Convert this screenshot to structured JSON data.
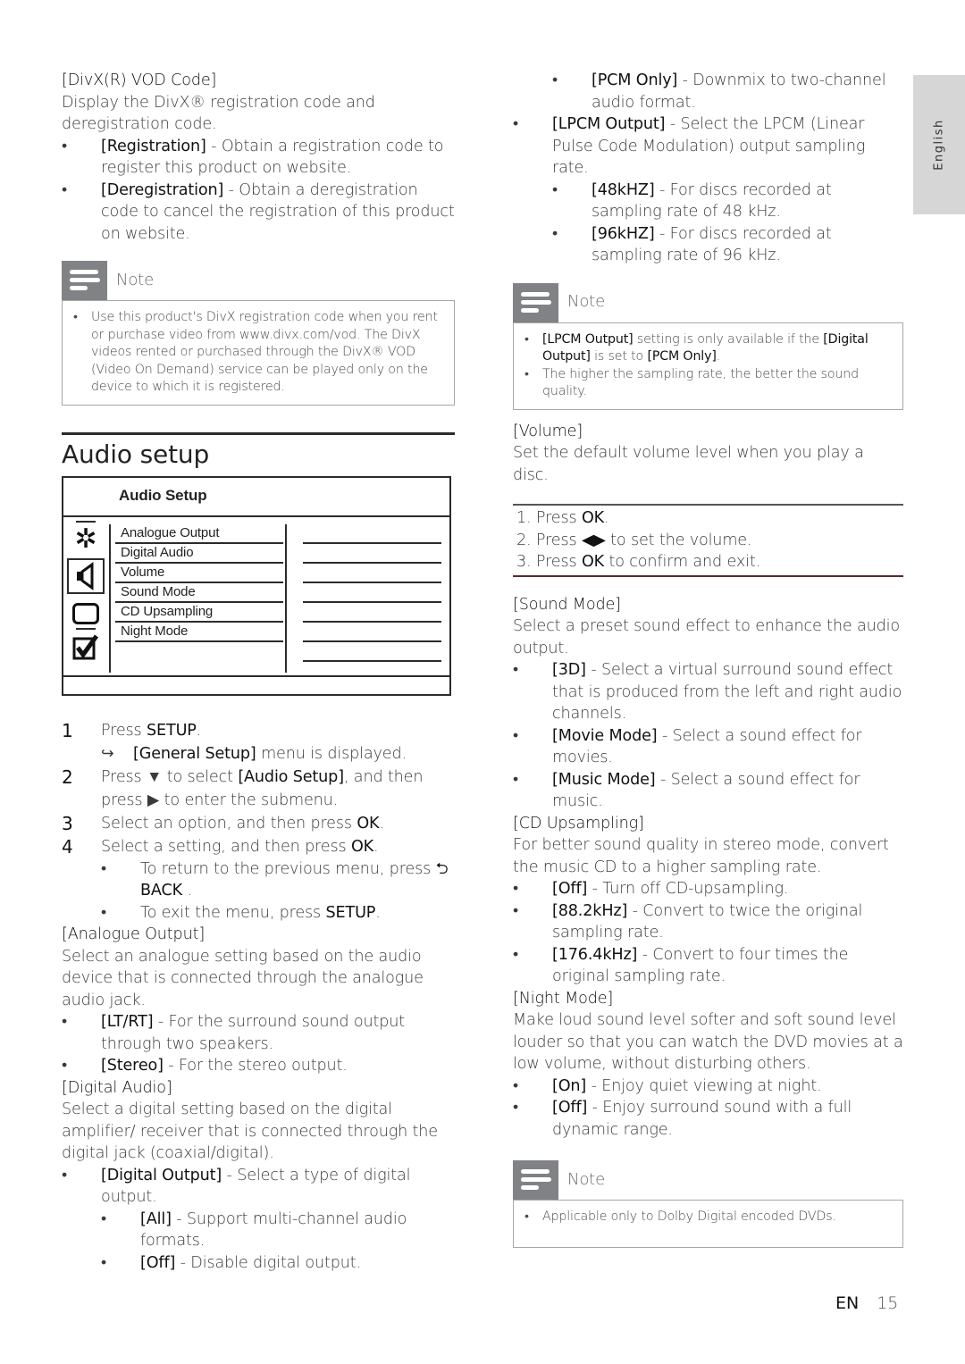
{
  "side_tab": {
    "label": "English"
  },
  "left": {
    "divx": {
      "heading": "[DivX(R) VOD Code]",
      "desc": "Display the DivX® registration code and deregistration code.",
      "items": [
        {
          "key": "[Registration]",
          "text": " - Obtain a registration code to register this product on website."
        },
        {
          "key": "[Deregistration]",
          "text": " - Obtain a deregistration code to cancel the registration of this product on website."
        }
      ]
    },
    "note1": {
      "label": "Note",
      "items": [
        "Use this product's DivX registration code when you rent or purchase video from www.divx.com/vod. The DivX videos rented or purchased through the DivX® VOD (Video On Demand) service can be played only on the device to which it is registered."
      ]
    },
    "section_title": "Audio setup",
    "menu": {
      "title": "Audio Setup",
      "options": [
        "Analogue Output",
        "Digital Audio",
        "Volume",
        "Sound Mode",
        "CD Upsampling",
        "Night Mode"
      ],
      "icons": [
        "gear-icon",
        "speaker-icon",
        "screen-icon",
        "checkbox-icon"
      ],
      "selected_icon": "speaker-icon"
    },
    "steps": [
      {
        "num": "1",
        "pre": "Press ",
        "bold": "SETUP",
        "post": "."
      },
      {
        "num": "2",
        "pre": "Press ▼ to select ",
        "bold": "[Audio Setup]",
        "post": ", and then press ▶ to enter the submenu."
      },
      {
        "num": "3",
        "pre": "Select an option, and then press ",
        "bold": "OK",
        "post": "."
      },
      {
        "num": "4",
        "pre": "Select a setting, and then press ",
        "bold": "OK",
        "post": "."
      }
    ],
    "step1_result": {
      "bold": "[General Setup]",
      "post": " menu is displayed."
    },
    "step4_bullets": [
      {
        "pre": "To return to the previous menu, press ",
        "bold": "⮌ BACK",
        "post": " ."
      },
      {
        "pre": "To exit the menu, press ",
        "bold": "SETUP",
        "post": "."
      }
    ],
    "analogue": {
      "heading": "[Analogue Output]",
      "desc": "Select an analogue setting based on the audio device that is connected through the analogue audio jack.",
      "items": [
        {
          "key": "[LT/RT]",
          "text": " - For the surround sound output through two speakers."
        },
        {
          "key": "[Stereo]",
          "text": " - For the stereo output."
        }
      ]
    },
    "digital": {
      "heading": "[Digital Audio]",
      "desc": "Select a digital setting based on the digital amplifier/ receiver that is connected through the digital jack (coaxial/digital).",
      "items": [
        {
          "key": "[Digital Output]",
          "text": " - Select a type of digital output."
        }
      ],
      "sub_items": [
        {
          "key": "[All]",
          "text": " - Support multi-channel audio formats."
        },
        {
          "key": "[Off]",
          "text": " - Disable digital output."
        }
      ]
    }
  },
  "right": {
    "pcm_only": {
      "key": "[PCM Only]",
      "text": " - Downmix to two-channel audio format."
    },
    "lpcm": {
      "key": "[LPCM Output]",
      "text": " - Select the LPCM (Linear Pulse Code Modulation) output sampling rate."
    },
    "lpcm_sub": [
      {
        "key": "[48kHZ]",
        "text": " - For discs recorded at sampling rate of 48 kHz."
      },
      {
        "key": "[96kHZ]",
        "text": " - For discs recorded at sampling rate of 96 kHz."
      }
    ],
    "note2": {
      "label": "Note",
      "item1": {
        "b1": "[LPCM Output]",
        "t1": " setting is only available if the ",
        "b2": "[Digital Output]",
        "t2": " is set to ",
        "b3": "[PCM Only]",
        "t3": "."
      },
      "item2": "The higher the sampling rate, the better the sound quality."
    },
    "volume": {
      "heading": "[Volume]",
      "desc": "Set the default volume level when you play a disc.",
      "steps": [
        {
          "pre": "1. Press ",
          "bold": "OK",
          "post": "."
        },
        {
          "pre": "2. Press ",
          "bold": "◀▶",
          "post": " to set the volume."
        },
        {
          "pre": "3. Press ",
          "bold": "OK",
          "post": " to confirm and exit."
        }
      ]
    },
    "sound_mode": {
      "heading": "[Sound Mode]",
      "desc": "Select a preset sound effect to enhance the audio output.",
      "items": [
        {
          "key": "[3D]",
          "text": " - Select a virtual surround sound effect that is produced from the left and right audio channels."
        },
        {
          "key": "[Movie Mode]",
          "text": " - Select a sound effect for movies."
        },
        {
          "key": "[Music Mode]",
          "text": " - Select a sound effect for music."
        }
      ]
    },
    "cd_upsampling": {
      "heading": "[CD Upsampling]",
      "desc": "For better sound quality in stereo mode, convert the music CD to a higher sampling rate.",
      "items": [
        {
          "key": "[Off]",
          "text": " - Turn off CD-upsampling."
        },
        {
          "key": "[88.2kHz]",
          "text": " - Convert to twice the original sampling rate."
        },
        {
          "key": "[176.4kHz]",
          "text": " - Convert to four times the original sampling rate."
        }
      ]
    },
    "night_mode": {
      "heading": "[Night Mode]",
      "desc": "Make loud sound level softer and soft sound level louder so that you can watch the DVD movies at a low volume, without disturbing others.",
      "items": [
        {
          "key": "[On]",
          "text": " - Enjoy quiet viewing at night."
        },
        {
          "key": "[Off]",
          "text": " - Enjoy surround sound with a full dynamic range."
        }
      ]
    },
    "note3": {
      "label": "Note",
      "items": [
        "Applicable only to Dolby Digital encoded DVDs."
      ]
    }
  },
  "footer": {
    "lang": "EN",
    "page": "15"
  }
}
